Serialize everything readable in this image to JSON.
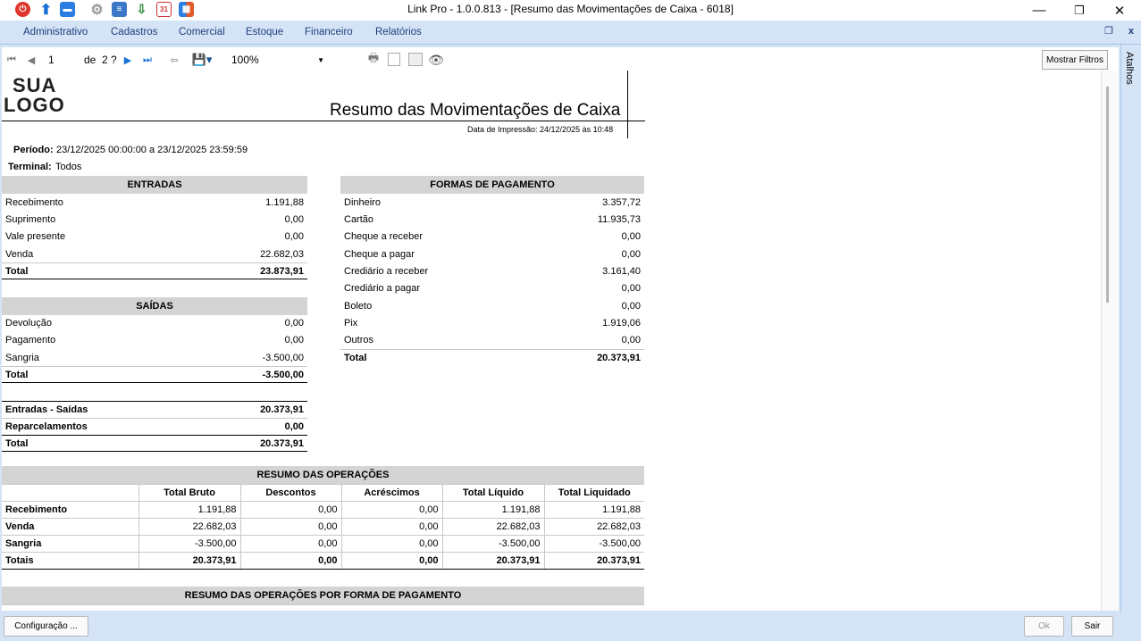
{
  "window": {
    "title": "Link Pro - 1.0.0.813 - [Resumo das Movimentações de Caixa - 6018]",
    "minimize_icon": "minimize-icon",
    "maximize_icon": "restore-icon",
    "close_icon": "close-icon"
  },
  "menu": [
    "Administrativo",
    "Cadastros",
    "Comercial",
    "Estoque",
    "Financeiro",
    "Relatórios"
  ],
  "side_panel_label": "Atalhos",
  "viewer": {
    "page": "1",
    "page_of": "de",
    "page_total": "2 ?",
    "zoom": "100%",
    "filters_button": "Mostrar Filtros"
  },
  "report": {
    "logo_line1": "SUA",
    "logo_line2": "LOGO",
    "title": "Resumo das Movimentações de Caixa",
    "print_date": "Data de Impressão: 24/12/2025 às 10:48",
    "period_label": "Período:",
    "period_value": "23/12/2025 00:00:00 a 23/12/2025 23:59:59",
    "terminal_label": "Terminal:",
    "terminal_value": "Todos",
    "entradas": {
      "header": "ENTRADAS",
      "rows": [
        {
          "label": "Recebimento",
          "value": "1.191,88"
        },
        {
          "label": "Suprimento",
          "value": "0,00"
        },
        {
          "label": "Vale presente",
          "value": "0,00"
        },
        {
          "label": "Venda",
          "value": "22.682,03"
        }
      ],
      "total_label": "Total",
      "total_value": "23.873,91"
    },
    "saidas": {
      "header": "SAÍDAS",
      "rows": [
        {
          "label": "Devolução",
          "value": "0,00"
        },
        {
          "label": "Pagamento",
          "value": "0,00"
        },
        {
          "label": "Sangria",
          "value": "-3.500,00"
        }
      ],
      "total_label": "Total",
      "total_value": "-3.500,00"
    },
    "summary": [
      {
        "label": "Entradas - Saídas",
        "value": "20.373,91"
      },
      {
        "label": "Reparcelamentos",
        "value": "0,00"
      },
      {
        "label": "Total",
        "value": "20.373,91"
      }
    ],
    "formas": {
      "header": "FORMAS DE PAGAMENTO",
      "rows": [
        {
          "label": "Dinheiro",
          "value": "3.357,72"
        },
        {
          "label": "Cartão",
          "value": "11.935,73"
        },
        {
          "label": "Cheque a receber",
          "value": "0,00"
        },
        {
          "label": "Cheque a pagar",
          "value": "0,00"
        },
        {
          "label": "Crediário a receber",
          "value": "3.161,40"
        },
        {
          "label": "Crediário a pagar",
          "value": "0,00"
        },
        {
          "label": "Boleto",
          "value": "0,00"
        },
        {
          "label": "Pix",
          "value": "1.919,06"
        },
        {
          "label": "Outros",
          "value": "0,00"
        }
      ],
      "total_label": "Total",
      "total_value": "20.373,91"
    },
    "operacoes": {
      "header": "RESUMO DAS OPERAÇÕES",
      "columns": [
        "",
        "Total Bruto",
        "Descontos",
        "Acréscimos",
        "Total Líquido",
        "Total Liquidado"
      ],
      "rows": [
        [
          "Recebimento",
          "1.191,88",
          "0,00",
          "0,00",
          "1.191,88",
          "1.191,88"
        ],
        [
          "Venda",
          "22.682,03",
          "0,00",
          "0,00",
          "22.682,03",
          "22.682,03"
        ],
        [
          "Sangria",
          "-3.500,00",
          "0,00",
          "0,00",
          "-3.500,00",
          "-3.500,00"
        ],
        [
          "Totais",
          "20.373,91",
          "0,00",
          "0,00",
          "20.373,91",
          "20.373,91"
        ]
      ]
    },
    "operacoes_forma_header": "RESUMO DAS OPERAÇÕES POR FORMA DE PAGAMENTO"
  },
  "bottom": {
    "config_button": "Configuração ...",
    "ok_button": "Ok",
    "exit_button": "Sair"
  },
  "colors": {
    "menubar": "#d4e4f6",
    "menu_text": "#1f3d7a",
    "section_header": "#d4d4d4"
  }
}
